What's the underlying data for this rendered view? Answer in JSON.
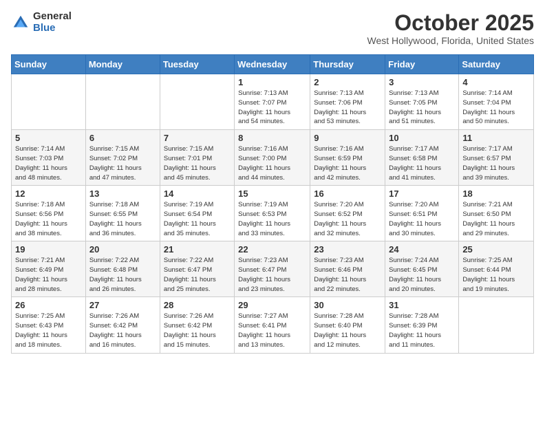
{
  "header": {
    "logo_general": "General",
    "logo_blue": "Blue",
    "month_title": "October 2025",
    "location": "West Hollywood, Florida, United States"
  },
  "columns": [
    "Sunday",
    "Monday",
    "Tuesday",
    "Wednesday",
    "Thursday",
    "Friday",
    "Saturday"
  ],
  "weeks": [
    [
      {
        "day": "",
        "info": ""
      },
      {
        "day": "",
        "info": ""
      },
      {
        "day": "",
        "info": ""
      },
      {
        "day": "1",
        "info": "Sunrise: 7:13 AM\nSunset: 7:07 PM\nDaylight: 11 hours\nand 54 minutes."
      },
      {
        "day": "2",
        "info": "Sunrise: 7:13 AM\nSunset: 7:06 PM\nDaylight: 11 hours\nand 53 minutes."
      },
      {
        "day": "3",
        "info": "Sunrise: 7:13 AM\nSunset: 7:05 PM\nDaylight: 11 hours\nand 51 minutes."
      },
      {
        "day": "4",
        "info": "Sunrise: 7:14 AM\nSunset: 7:04 PM\nDaylight: 11 hours\nand 50 minutes."
      }
    ],
    [
      {
        "day": "5",
        "info": "Sunrise: 7:14 AM\nSunset: 7:03 PM\nDaylight: 11 hours\nand 48 minutes."
      },
      {
        "day": "6",
        "info": "Sunrise: 7:15 AM\nSunset: 7:02 PM\nDaylight: 11 hours\nand 47 minutes."
      },
      {
        "day": "7",
        "info": "Sunrise: 7:15 AM\nSunset: 7:01 PM\nDaylight: 11 hours\nand 45 minutes."
      },
      {
        "day": "8",
        "info": "Sunrise: 7:16 AM\nSunset: 7:00 PM\nDaylight: 11 hours\nand 44 minutes."
      },
      {
        "day": "9",
        "info": "Sunrise: 7:16 AM\nSunset: 6:59 PM\nDaylight: 11 hours\nand 42 minutes."
      },
      {
        "day": "10",
        "info": "Sunrise: 7:17 AM\nSunset: 6:58 PM\nDaylight: 11 hours\nand 41 minutes."
      },
      {
        "day": "11",
        "info": "Sunrise: 7:17 AM\nSunset: 6:57 PM\nDaylight: 11 hours\nand 39 minutes."
      }
    ],
    [
      {
        "day": "12",
        "info": "Sunrise: 7:18 AM\nSunset: 6:56 PM\nDaylight: 11 hours\nand 38 minutes."
      },
      {
        "day": "13",
        "info": "Sunrise: 7:18 AM\nSunset: 6:55 PM\nDaylight: 11 hours\nand 36 minutes."
      },
      {
        "day": "14",
        "info": "Sunrise: 7:19 AM\nSunset: 6:54 PM\nDaylight: 11 hours\nand 35 minutes."
      },
      {
        "day": "15",
        "info": "Sunrise: 7:19 AM\nSunset: 6:53 PM\nDaylight: 11 hours\nand 33 minutes."
      },
      {
        "day": "16",
        "info": "Sunrise: 7:20 AM\nSunset: 6:52 PM\nDaylight: 11 hours\nand 32 minutes."
      },
      {
        "day": "17",
        "info": "Sunrise: 7:20 AM\nSunset: 6:51 PM\nDaylight: 11 hours\nand 30 minutes."
      },
      {
        "day": "18",
        "info": "Sunrise: 7:21 AM\nSunset: 6:50 PM\nDaylight: 11 hours\nand 29 minutes."
      }
    ],
    [
      {
        "day": "19",
        "info": "Sunrise: 7:21 AM\nSunset: 6:49 PM\nDaylight: 11 hours\nand 28 minutes."
      },
      {
        "day": "20",
        "info": "Sunrise: 7:22 AM\nSunset: 6:48 PM\nDaylight: 11 hours\nand 26 minutes."
      },
      {
        "day": "21",
        "info": "Sunrise: 7:22 AM\nSunset: 6:47 PM\nDaylight: 11 hours\nand 25 minutes."
      },
      {
        "day": "22",
        "info": "Sunrise: 7:23 AM\nSunset: 6:47 PM\nDaylight: 11 hours\nand 23 minutes."
      },
      {
        "day": "23",
        "info": "Sunrise: 7:23 AM\nSunset: 6:46 PM\nDaylight: 11 hours\nand 22 minutes."
      },
      {
        "day": "24",
        "info": "Sunrise: 7:24 AM\nSunset: 6:45 PM\nDaylight: 11 hours\nand 20 minutes."
      },
      {
        "day": "25",
        "info": "Sunrise: 7:25 AM\nSunset: 6:44 PM\nDaylight: 11 hours\nand 19 minutes."
      }
    ],
    [
      {
        "day": "26",
        "info": "Sunrise: 7:25 AM\nSunset: 6:43 PM\nDaylight: 11 hours\nand 18 minutes."
      },
      {
        "day": "27",
        "info": "Sunrise: 7:26 AM\nSunset: 6:42 PM\nDaylight: 11 hours\nand 16 minutes."
      },
      {
        "day": "28",
        "info": "Sunrise: 7:26 AM\nSunset: 6:42 PM\nDaylight: 11 hours\nand 15 minutes."
      },
      {
        "day": "29",
        "info": "Sunrise: 7:27 AM\nSunset: 6:41 PM\nDaylight: 11 hours\nand 13 minutes."
      },
      {
        "day": "30",
        "info": "Sunrise: 7:28 AM\nSunset: 6:40 PM\nDaylight: 11 hours\nand 12 minutes."
      },
      {
        "day": "31",
        "info": "Sunrise: 7:28 AM\nSunset: 6:39 PM\nDaylight: 11 hours\nand 11 minutes."
      },
      {
        "day": "",
        "info": ""
      }
    ]
  ]
}
